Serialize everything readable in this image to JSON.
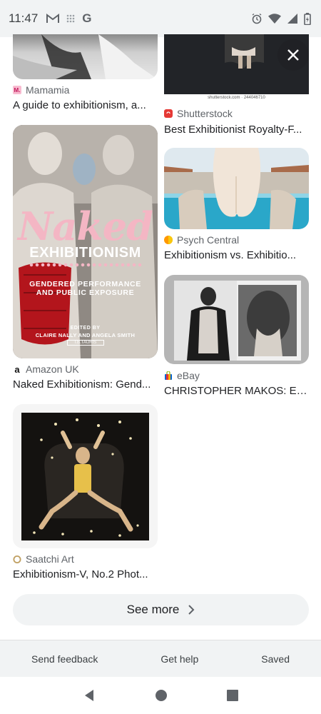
{
  "status_bar": {
    "time": "11:47",
    "left_icons": [
      "gmail-icon",
      "grid-icon",
      "google-icon"
    ],
    "right_icons": [
      "alarm-icon",
      "wifi-icon",
      "signal-icon",
      "battery-icon"
    ]
  },
  "results": [
    {
      "source": "Mamamia",
      "title": "A guide to exhibitionism, a...",
      "favicon_color": "#f8bbd0",
      "favicon_letter": "M."
    },
    {
      "source": "Shutterstock",
      "title": "Best Exhibitionist Royalty-F...",
      "favicon_color": "#e53935",
      "favicon_letter": "",
      "watermark": "shutterstock.com · 244046710"
    },
    {
      "source": "Amazon UK",
      "title": "Naked Exhibitionism: Gend...",
      "favicon_color": "#ffffff",
      "favicon_letter": "a",
      "book": {
        "title_1": "Naked",
        "title_2": "EXHIBITIONISM",
        "subtitle_1": "GENDERED PERFORMANCE",
        "subtitle_2": "AND PUBLIC EXPOSURE",
        "edited_by": "EDITED BY",
        "editors": "CLAIRE NALLY AND ANGELA SMITH",
        "publisher": "I.B.TAURIS"
      }
    },
    {
      "source": "Psych Central",
      "title": "Exhibitionism vs. Exhibitio...",
      "favicon_color": "#ff9800",
      "favicon_letter": ""
    },
    {
      "source": "eBay",
      "title": "CHRISTOPHER MAKOS: Ex...",
      "favicon_color": "#ffffff",
      "favicon_letter": ""
    },
    {
      "source": "Saatchi Art",
      "title": "Exhibitionism-V, No.2 Phot...",
      "favicon_color": "#ffffff",
      "favicon_letter": ""
    }
  ],
  "see_more": {
    "label": "See more"
  },
  "footer": {
    "feedback": "Send feedback",
    "help": "Get help",
    "saved": "Saved"
  },
  "nav": [
    "back-icon",
    "home-icon",
    "recents-icon"
  ]
}
